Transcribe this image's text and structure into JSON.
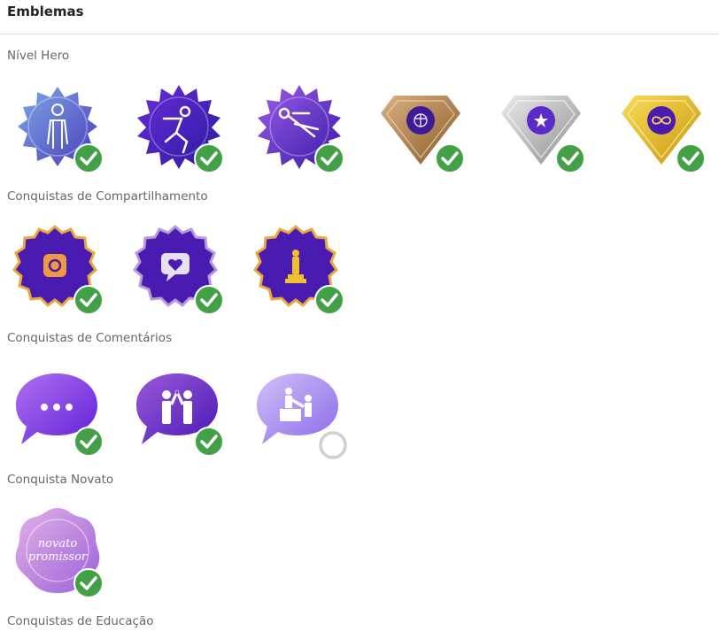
{
  "page_title": "Emblemas",
  "sections": [
    {
      "title": "Nível Hero",
      "badges": [
        {
          "name": "hero-suit",
          "earned": true
        },
        {
          "name": "hero-run",
          "earned": true
        },
        {
          "name": "hero-fly",
          "earned": true
        },
        {
          "name": "bronze-diamond",
          "earned": true
        },
        {
          "name": "silver-diamond",
          "earned": true
        },
        {
          "name": "gold-diamond",
          "earned": true
        }
      ]
    },
    {
      "title": "Conquistas de Compartilhamento",
      "badges": [
        {
          "name": "instagram",
          "earned": true
        },
        {
          "name": "love-message",
          "earned": true
        },
        {
          "name": "oscar",
          "earned": true
        }
      ]
    },
    {
      "title": "Conquistas de Comentários",
      "badges": [
        {
          "name": "chat-dots",
          "earned": true
        },
        {
          "name": "chat-highfive",
          "earned": true
        },
        {
          "name": "chat-helping",
          "earned": false
        }
      ]
    },
    {
      "title": "Conquista Novato",
      "badges": [
        {
          "name": "novato-promissor",
          "earned": true,
          "text_line1": "novato",
          "text_line2": "promissor"
        }
      ]
    },
    {
      "title": "Conquistas de Educação",
      "badges": []
    }
  ],
  "colors": {
    "check": "#43a047",
    "unearned_ring": "#cfcfcf",
    "purple": "#4a1bb0"
  }
}
